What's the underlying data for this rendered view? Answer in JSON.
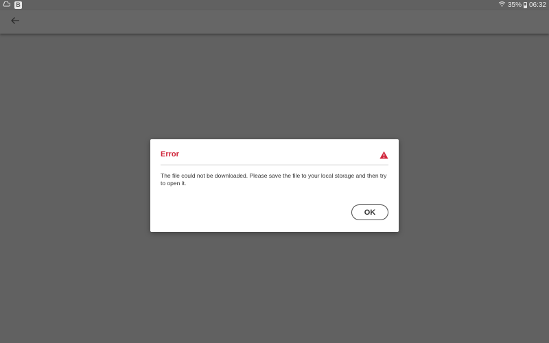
{
  "status_bar": {
    "left_badge": "B",
    "battery_percent": "35%",
    "time": "06:32",
    "icons": [
      "cloud-icon",
      "b-badge-icon",
      "wifi-icon",
      "battery-icon"
    ]
  },
  "app_bar": {
    "back_icon": "arrow-left-icon"
  },
  "dialog": {
    "title": "Error",
    "title_color": "#d0253a",
    "icon": "warning-icon",
    "message": "The file could not be downloaded. Please save the file to your local storage and then try to open it.",
    "ok_label": "OK"
  },
  "colors": {
    "background": "#616161",
    "dialog_bg": "#ffffff",
    "accent_red": "#d0253a"
  }
}
